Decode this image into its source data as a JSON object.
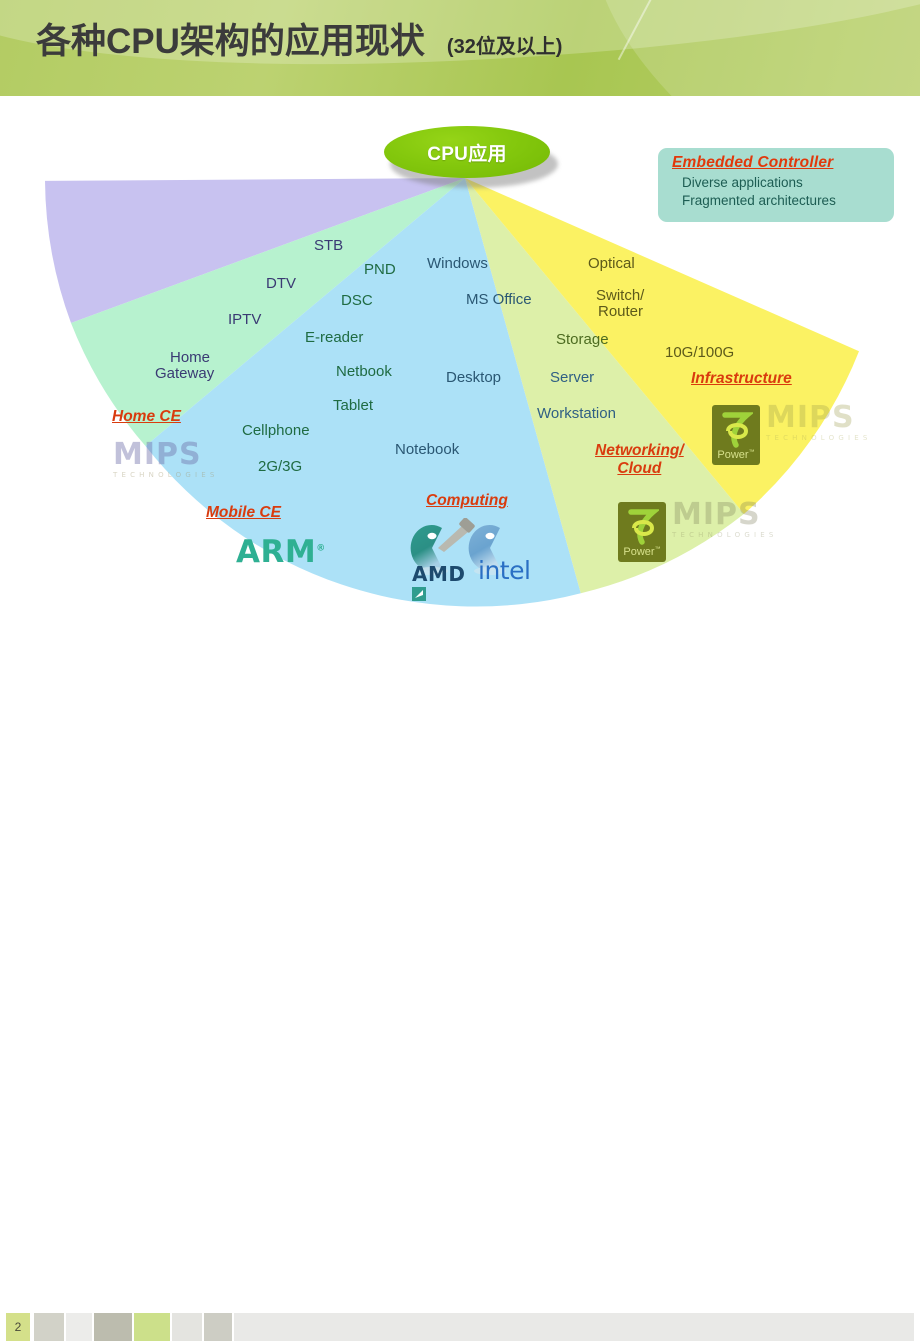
{
  "header": {
    "title_main": "各种CPU架构的应用现状",
    "title_sub": "(32位及以上)"
  },
  "center_node": {
    "label": "CPU应用"
  },
  "callout": {
    "title": "Embedded Controller",
    "line1": "Diverse applications",
    "line2": "Fragmented  architectures"
  },
  "segments": {
    "home_ce": {
      "category": "Home CE",
      "items": [
        "STB",
        "DTV",
        "IPTV",
        "Home",
        "Gateway"
      ],
      "logo": "mips-logo"
    },
    "mobile_ce": {
      "category": "Mobile CE",
      "items": [
        "PND",
        "DSC",
        "E-reader",
        "Netbook",
        "Tablet",
        "Cellphone",
        "2G/3G"
      ],
      "logo": "arm-logo"
    },
    "computing": {
      "category": "Computing",
      "items": [
        "Windows",
        "MS Office",
        "Desktop",
        "Notebook"
      ],
      "logos": [
        "amd-logo",
        "intel-logo"
      ]
    },
    "networking_cloud": {
      "category_line1": "Networking/",
      "category_line2": "Cloud",
      "items": [
        "Storage",
        "Server",
        "Workstation"
      ],
      "logos": [
        "power-logo",
        "mips-logo"
      ]
    },
    "infrastructure": {
      "category": "Infrastructure",
      "items": [
        "Optical",
        "Switch/",
        "Router",
        "10G/100G"
      ],
      "logos": [
        "power-logo",
        "mips-logo"
      ]
    }
  },
  "logos": {
    "mips_word": "MIPS",
    "mips_sub": "TECHNOLOGIES",
    "arm_word": "ARM",
    "arm_tm": "®",
    "power_word": "Power",
    "power_tm": "™",
    "amd_word": "AMD",
    "intel_word": "intel"
  },
  "footer": {
    "page_number": "2"
  },
  "colors": {
    "header_green": "#b3cc63",
    "oval_green": "#84c80d",
    "callout_bg": "#a8ddd0",
    "callout_title": "#e1380b",
    "category_red": "#d93b0e",
    "seg_home_ce": "#c9c3f0",
    "seg_mobile_ce": "#b6f2ce",
    "seg_computing": "#ade2f7",
    "seg_networking": "#ddf0a8",
    "seg_infrastructure": "#fbf263",
    "arm_teal": "#2fb093",
    "power_olive": "#6f7b1e"
  }
}
